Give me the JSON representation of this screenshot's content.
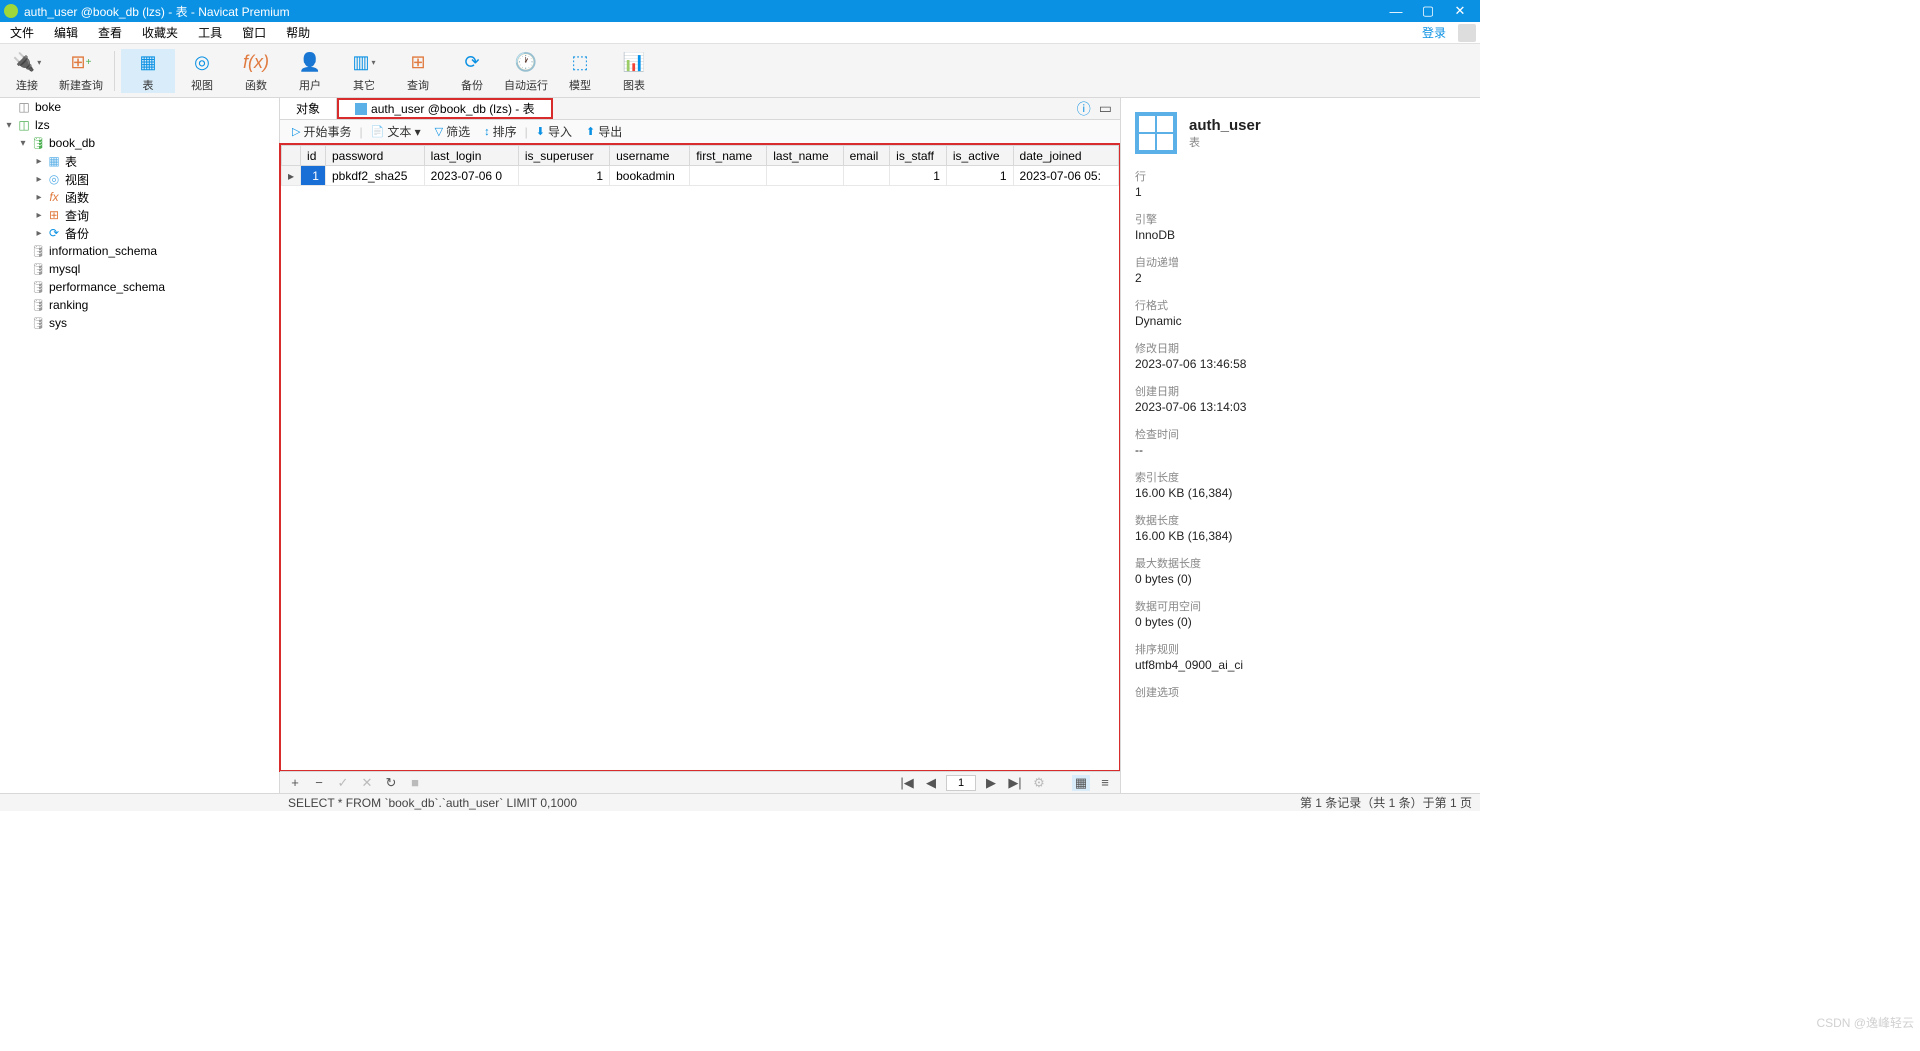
{
  "window": {
    "title": "auth_user @book_db (lzs) - 表 - Navicat Premium"
  },
  "menubar": {
    "items": [
      "文件",
      "编辑",
      "查看",
      "收藏夹",
      "工具",
      "窗口",
      "帮助"
    ],
    "login": "登录"
  },
  "toolbar": [
    {
      "label": "连接",
      "icon": "plug"
    },
    {
      "label": "新建查询",
      "icon": "newquery"
    },
    {
      "label": "表",
      "icon": "table",
      "active": true
    },
    {
      "label": "视图",
      "icon": "view"
    },
    {
      "label": "函数",
      "icon": "fx"
    },
    {
      "label": "用户",
      "icon": "user"
    },
    {
      "label": "其它",
      "icon": "other"
    },
    {
      "label": "查询",
      "icon": "query"
    },
    {
      "label": "备份",
      "icon": "backup"
    },
    {
      "label": "自动运行",
      "icon": "auto"
    },
    {
      "label": "模型",
      "icon": "model"
    },
    {
      "label": "图表",
      "icon": "chart"
    }
  ],
  "tree": [
    {
      "level": 0,
      "arrow": "",
      "icon": "conn",
      "label": "boke"
    },
    {
      "level": 0,
      "arrow": "▾",
      "icon": "conn-active",
      "label": "lzs"
    },
    {
      "level": 1,
      "arrow": "▾",
      "icon": "db",
      "label": "book_db"
    },
    {
      "level": 2,
      "arrow": "▸",
      "icon": "table",
      "label": "表"
    },
    {
      "level": 2,
      "arrow": "▸",
      "icon": "view",
      "label": "视图"
    },
    {
      "level": 2,
      "arrow": "▸",
      "icon": "fx",
      "label": "函数"
    },
    {
      "level": 2,
      "arrow": "▸",
      "icon": "query",
      "label": "查询"
    },
    {
      "level": 2,
      "arrow": "▸",
      "icon": "backup",
      "label": "备份"
    },
    {
      "level": 1,
      "arrow": "",
      "icon": "db-closed",
      "label": "information_schema"
    },
    {
      "level": 1,
      "arrow": "",
      "icon": "db-closed",
      "label": "mysql"
    },
    {
      "level": 1,
      "arrow": "",
      "icon": "db-closed",
      "label": "performance_schema"
    },
    {
      "level": 1,
      "arrow": "",
      "icon": "db-closed",
      "label": "ranking"
    },
    {
      "level": 1,
      "arrow": "",
      "icon": "db-closed",
      "label": "sys"
    }
  ],
  "tabs": [
    {
      "label": "对象",
      "active": false
    },
    {
      "label": "auth_user @book_db (lzs) - 表",
      "active": true
    }
  ],
  "subtoolbar": [
    {
      "icon": "▶",
      "label": "开始事务"
    },
    {
      "icon": "📄",
      "label": "文本 ▾"
    },
    {
      "icon": "▼",
      "label": "筛选"
    },
    {
      "icon": "↕",
      "label": "排序"
    },
    {
      "icon": "↘",
      "label": "导入"
    },
    {
      "icon": "↗",
      "label": "导出"
    }
  ],
  "table": {
    "columns": [
      "id",
      "password",
      "last_login",
      "is_superuser",
      "username",
      "first_name",
      "last_name",
      "email",
      "is_staff",
      "is_active",
      "date_joined"
    ],
    "rows": [
      {
        "id": "1",
        "password": "pbkdf2_sha25",
        "last_login": "2023-07-06 0",
        "is_superuser": "1",
        "username": "bookadmin",
        "first_name": "",
        "last_name": "",
        "email": "",
        "is_staff": "1",
        "is_active": "1",
        "date_joined": "2023-07-06 05:"
      }
    ]
  },
  "bottombar": {
    "page": "1"
  },
  "props": {
    "heading": "auth_user",
    "sub": "表",
    "items": [
      {
        "label": "行",
        "value": "1"
      },
      {
        "label": "引擎",
        "value": "InnoDB"
      },
      {
        "label": "自动递增",
        "value": "2"
      },
      {
        "label": "行格式",
        "value": "Dynamic"
      },
      {
        "label": "修改日期",
        "value": "2023-07-06 13:46:58"
      },
      {
        "label": "创建日期",
        "value": "2023-07-06 13:14:03"
      },
      {
        "label": "检查时间",
        "value": "--"
      },
      {
        "label": "索引长度",
        "value": "16.00 KB (16,384)"
      },
      {
        "label": "数据长度",
        "value": "16.00 KB (16,384)"
      },
      {
        "label": "最大数据长度",
        "value": "0 bytes (0)"
      },
      {
        "label": "数据可用空间",
        "value": "0 bytes (0)"
      },
      {
        "label": "排序规则",
        "value": "utf8mb4_0900_ai_ci"
      },
      {
        "label": "创建选项",
        "value": ""
      }
    ]
  },
  "status": {
    "sql": "SELECT * FROM `book_db`.`auth_user` LIMIT 0,1000",
    "record": "第 1 条记录（共 1 条）于第 1 页"
  },
  "watermark": "CSDN @逸峰轻云"
}
